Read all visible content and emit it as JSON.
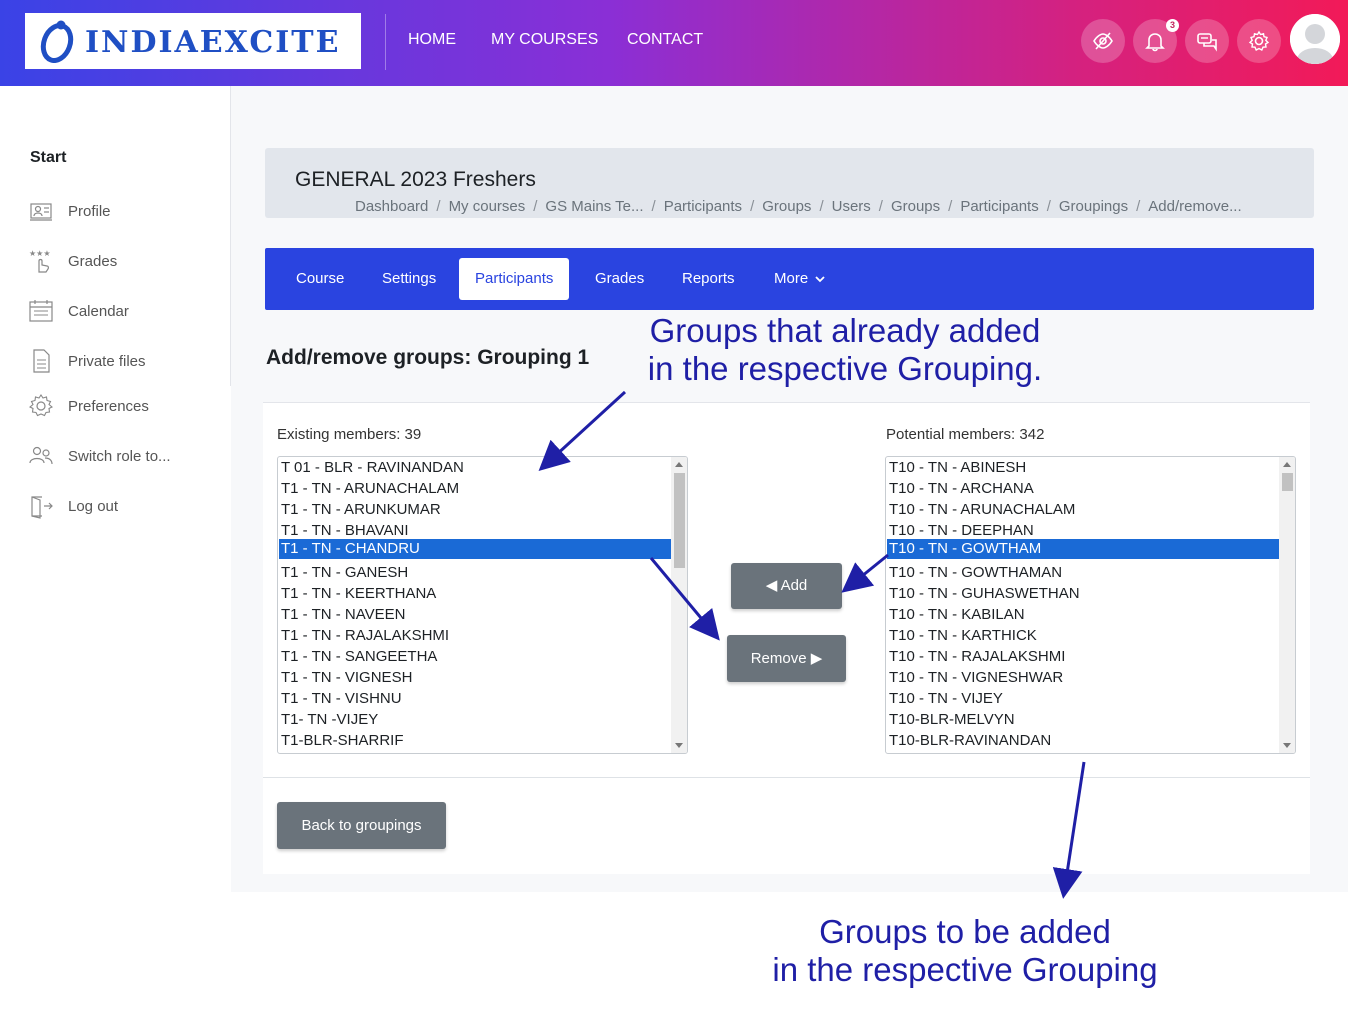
{
  "brand": {
    "name": "INDIAEXCITE"
  },
  "topnav": {
    "items": [
      "HOME",
      "MY COURSES",
      "CONTACT"
    ]
  },
  "header_icons": {
    "notifications_count": "3",
    "icons": [
      "eye-slash-icon",
      "bell-icon",
      "chat-icon",
      "gear-icon",
      "user-avatar"
    ]
  },
  "sidebar": {
    "heading": "Start",
    "items": [
      {
        "label": "Profile",
        "icon": "profile-icon"
      },
      {
        "label": "Grades",
        "icon": "grades-icon"
      },
      {
        "label": "Calendar",
        "icon": "calendar-icon"
      },
      {
        "label": "Private files",
        "icon": "file-icon"
      },
      {
        "label": "Preferences",
        "icon": "gear-icon"
      },
      {
        "label": "Switch role to...",
        "icon": "users-icon"
      },
      {
        "label": "Log out",
        "icon": "logout-icon"
      }
    ]
  },
  "page": {
    "course_title": "GENERAL 2023 Freshers",
    "breadcrumb": [
      "Dashboard",
      "My courses",
      "GS Mains Te...",
      "Participants",
      "Groups",
      "Users",
      "Groups",
      "Participants",
      "Groupings",
      "Add/remove..."
    ],
    "tabs": [
      "Course",
      "Settings",
      "Participants",
      "Grades",
      "Reports",
      "More"
    ],
    "active_tab": "Participants",
    "heading": "Add/remove groups: Grouping 1"
  },
  "existing": {
    "label": "Existing members: 39",
    "items": [
      "T 01 - BLR - RAVINANDAN",
      "T1 - TN - ARUNACHALAM",
      "T1 - TN - ARUNKUMAR",
      "T1 - TN - BHAVANI",
      "T1 - TN - CHANDRU",
      "T1 - TN - GANESH",
      "T1 - TN - KEERTHANA",
      "T1 - TN - NAVEEN",
      "T1 - TN - RAJALAKSHMI",
      "T1 - TN - SANGEETHA",
      "T1 - TN - VIGNESH",
      "T1 - TN - VISHNU",
      "T1- TN -VIJEY",
      "T1-BLR-SHARRIF"
    ],
    "selected": "T1 - TN - CHANDRU"
  },
  "potential": {
    "label": "Potential members: 342",
    "items": [
      "T10 - TN - ABINESH",
      "T10 - TN - ARCHANA",
      "T10 - TN - ARUNACHALAM",
      "T10 - TN - DEEPHAN",
      "T10 - TN - GOWTHAM",
      "T10 - TN - GOWTHAMAN",
      "T10 - TN - GUHASWETHAN",
      "T10 - TN - KABILAN",
      "T10 - TN - KARTHICK",
      "T10 - TN - RAJALAKSHMI",
      "T10 - TN - VIGNESHWAR",
      "T10 - TN - VIJEY",
      "T10-BLR-MELVYN",
      "T10-BLR-RAVINANDAN"
    ],
    "selected": "T10 - TN - GOWTHAM"
  },
  "buttons": {
    "add": "◀ Add",
    "remove": "Remove ▶",
    "back": "Back to groupings"
  },
  "annotations": {
    "top_line1": "Groups that already added",
    "top_line2": "in the respective Grouping.",
    "bottom_line1": "Groups to be added",
    "bottom_line2": "in the respective Grouping"
  },
  "colors": {
    "annotation": "#1f1fa6",
    "nav_bar": "#2a44e0",
    "selection": "#1a6ad6",
    "button": "#6a737b"
  }
}
